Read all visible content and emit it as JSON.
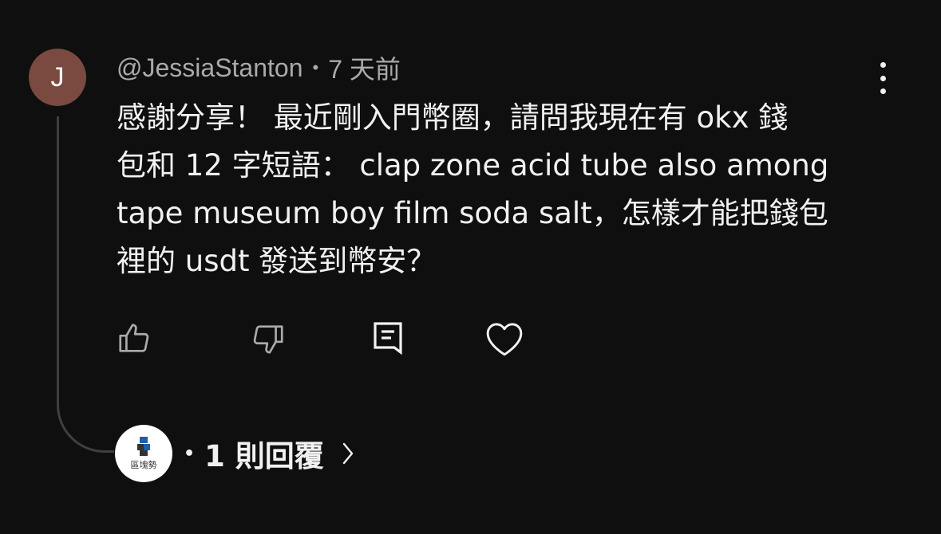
{
  "comment": {
    "avatar_letter": "J",
    "author": "@JessiaStanton",
    "separator": "•",
    "time": "7 天前",
    "text": "感謝分享！  最近剛入門幣圈，請問我現在有 okx 錢\n包和 12 字短語：  clap zone acid tube also among\ntape museum boy film soda salt，怎樣才能把錢包\n裡的 usdt 發送到幣安？"
  },
  "actions": {
    "like": "thumbs-up-icon",
    "dislike": "thumbs-down-icon",
    "reply": "comment-icon",
    "heart": "heart-icon"
  },
  "replies": {
    "channel_logo_text": "區塊勢",
    "separator": "•",
    "count_label": "1 則回覆"
  },
  "colors": {
    "background": "#0f0f0f",
    "text": "#f1f1f1",
    "muted": "#aaaaaa",
    "avatar": "#7a4a40"
  }
}
